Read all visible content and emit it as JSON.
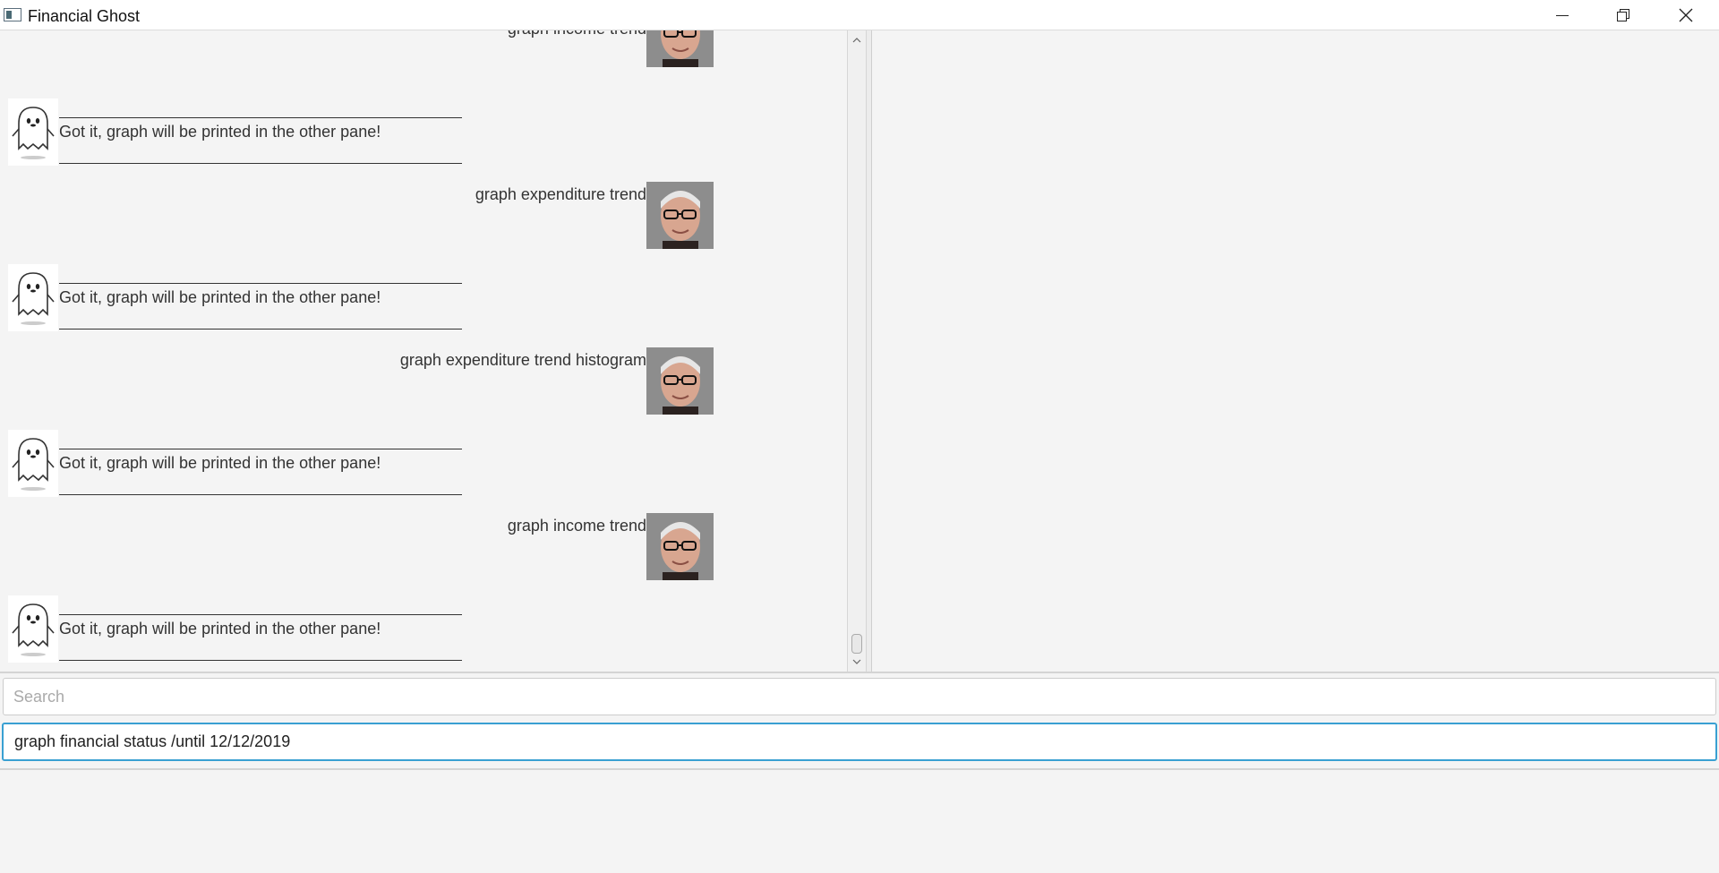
{
  "window": {
    "title": "Financial Ghost",
    "minimize_icon": "minimize-icon",
    "maximize_icon": "restore-icon",
    "close_icon": "close-icon"
  },
  "chat": {
    "messages": [
      {
        "sender": "user",
        "text": "graph income trend"
      },
      {
        "sender": "bot",
        "separator": "______________________________________________________",
        "text": "Got it, graph will be printed in the other pane!"
      },
      {
        "sender": "user",
        "text": "graph expenditure trend"
      },
      {
        "sender": "bot",
        "separator": "______________________________________________________",
        "text": "Got it, graph will be printed in the other pane!"
      },
      {
        "sender": "user",
        "text": "graph expenditure trend histogram"
      },
      {
        "sender": "bot",
        "separator": "______________________________________________________",
        "text": "Got it, graph will be printed in the other pane!"
      },
      {
        "sender": "user",
        "text": "graph income trend"
      },
      {
        "sender": "bot",
        "separator": "______________________________________________________",
        "text": "Got it, graph will be printed in the other pane!"
      }
    ]
  },
  "inputs": {
    "search_placeholder": "Search",
    "command_value": "graph financial status /until 12/12/2019"
  },
  "colors": {
    "accent_focus": "#39a0d2",
    "background": "#f4f4f4"
  }
}
